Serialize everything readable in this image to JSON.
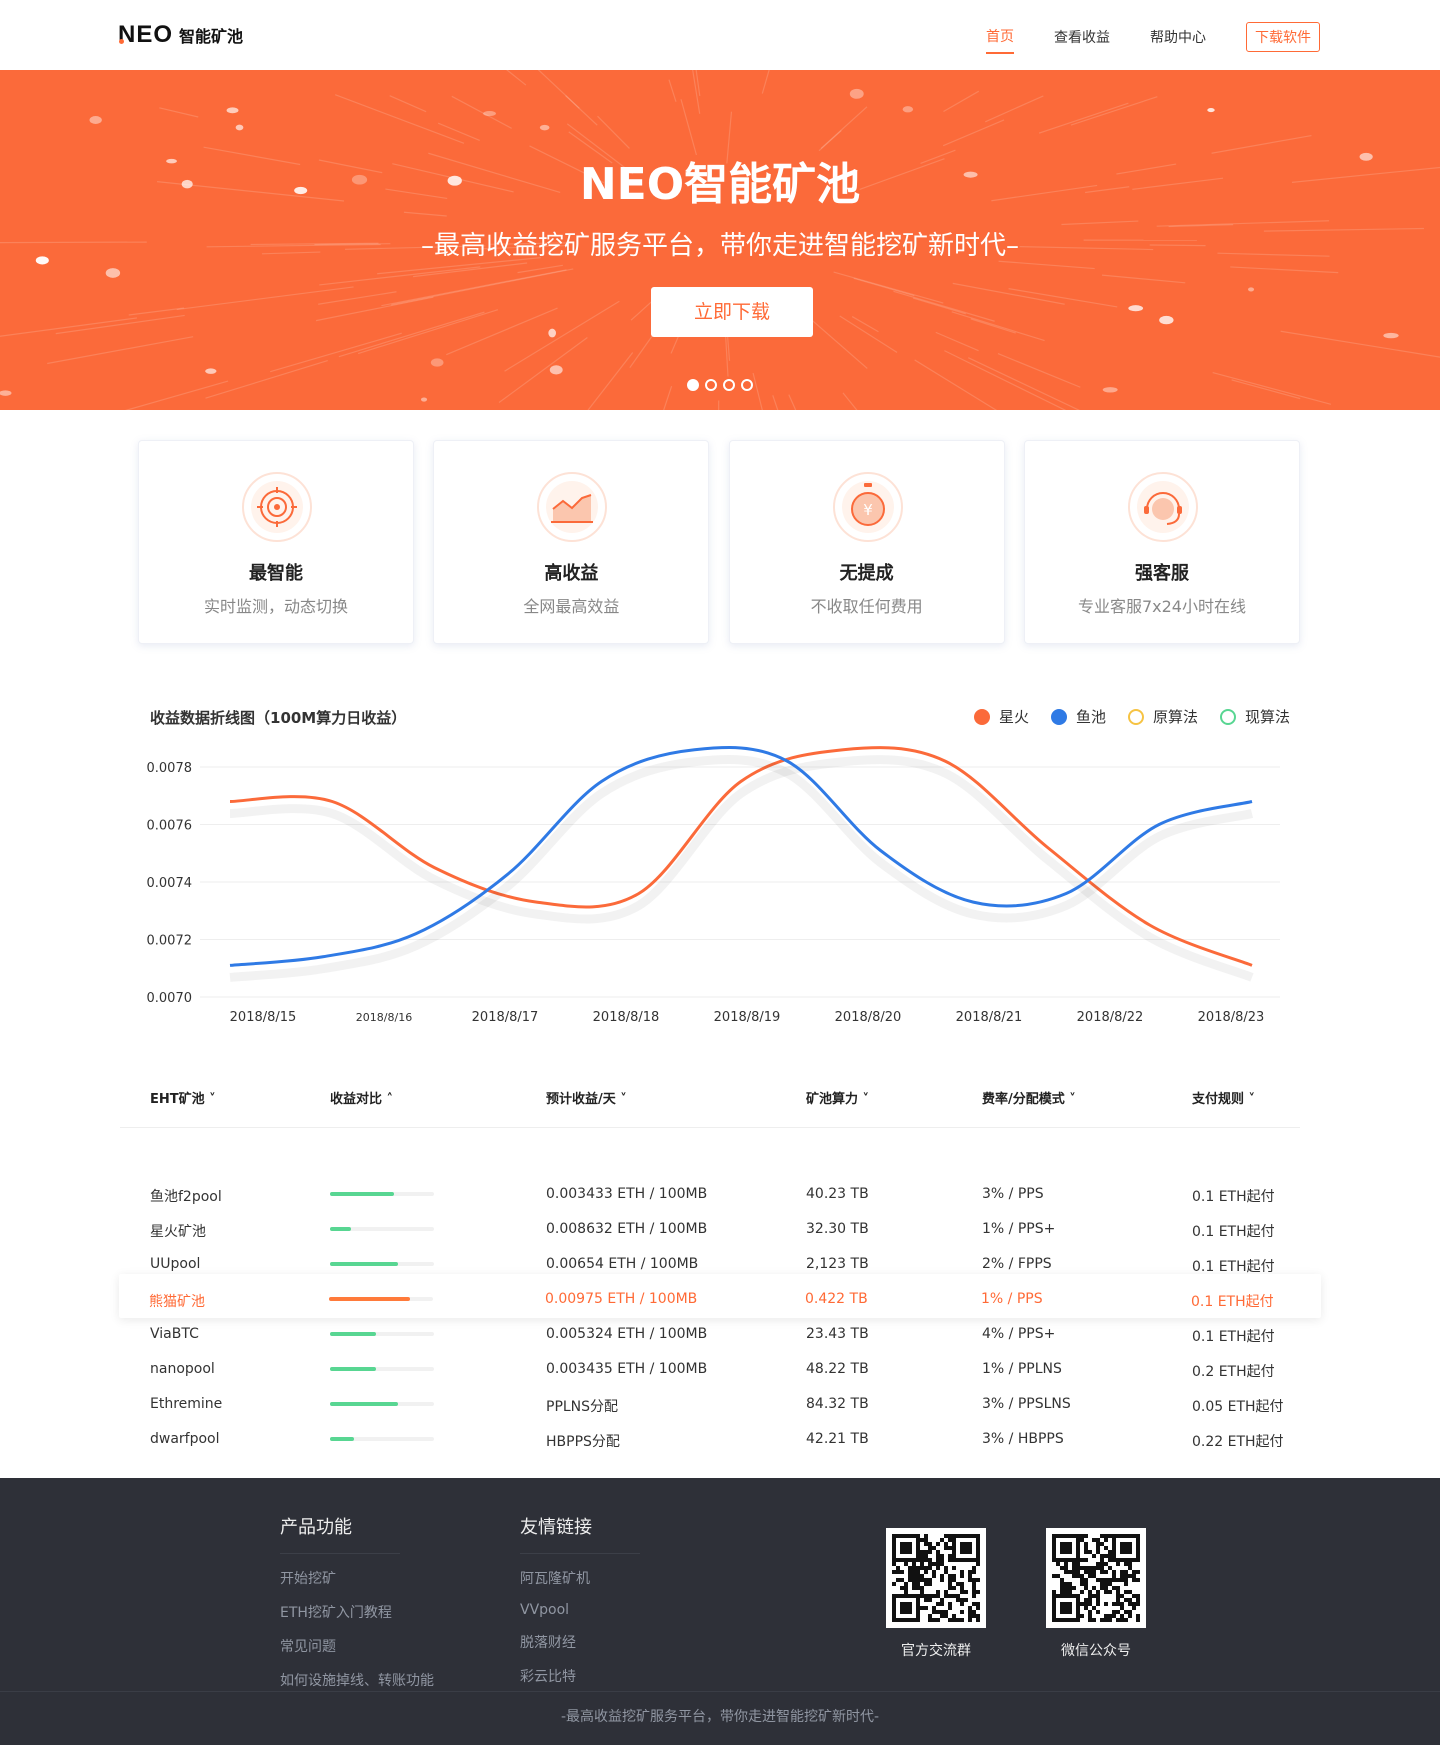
{
  "header": {
    "logo_mark": "NEO",
    "logo_text": "智能矿池",
    "nav": [
      {
        "label": "首页"
      },
      {
        "label": "查看收益"
      },
      {
        "label": "帮助中心"
      }
    ],
    "download_label": "下载软件"
  },
  "banner": {
    "title": "NEO智能矿池",
    "subtitle": "–最高收益挖矿服务平台，带你走进智能挖矿新时代–",
    "button_label": "立即下载",
    "slide_count": 4,
    "active_slide": 0
  },
  "features": [
    {
      "title": "最智能",
      "desc": "实时监测，动态切换",
      "icon": "target-icon"
    },
    {
      "title": "高收益",
      "desc": "全网最高效益",
      "icon": "chart-growth-icon"
    },
    {
      "title": "无提成",
      "desc": "不收取任何费用",
      "icon": "yuan-coin-icon"
    },
    {
      "title": "强客服",
      "desc": "专业客服7x24小时在线",
      "icon": "headset-icon"
    }
  ],
  "chart_section": {
    "title": "收益数据折线图（100M算力日收益）",
    "legend": [
      {
        "label": "星火",
        "color": "#fb6a3a",
        "filled": true
      },
      {
        "label": "鱼池",
        "color": "#2f7ae5",
        "filled": true
      },
      {
        "label": "原算法",
        "color": "#f6c343",
        "filled": false
      },
      {
        "label": "现算法",
        "color": "#58d692",
        "filled": false
      }
    ]
  },
  "chart_data": {
    "type": "line",
    "x": [
      "2018/8/15",
      "2018/8/16",
      "2018/8/17",
      "2018/8/18",
      "2018/8/19",
      "2018/8/20",
      "2018/8/21",
      "2018/8/22",
      "2018/8/23"
    ],
    "ylim": [
      0.007,
      0.0078
    ],
    "yticks": [
      "0.0078",
      "0.0076",
      "0.0074",
      "0.0072",
      "0.0070"
    ],
    "grid": true,
    "series": [
      {
        "name": "星火",
        "color": "#fb6a3a",
        "values": [
          0.00768,
          0.00768,
          0.00745,
          0.00733,
          0.00736,
          0.00775,
          0.00786,
          0.00782,
          0.00752,
          0.00725,
          0.00711
        ]
      },
      {
        "name": "鱼池",
        "color": "#2f7ae5",
        "values": [
          0.00711,
          0.00714,
          0.00722,
          0.00743,
          0.00775,
          0.00786,
          0.00782,
          0.00751,
          0.00733,
          0.00736,
          0.0076,
          0.00768
        ]
      }
    ]
  },
  "table": {
    "headers": [
      "EHT矿池",
      "收益对比",
      "预计收益/天",
      "矿池算力",
      "费率/分配模式",
      "支付规则"
    ],
    "rows": [
      {
        "pool": "鱼池f2pool",
        "ratio": 0.62,
        "income": "0.003433 ETH / 100MB",
        "hashrate": "40.23 TB",
        "fee": "3% / PPS",
        "pay": "0.1 ETH起付",
        "highlight": false
      },
      {
        "pool": "星火矿池",
        "ratio": 0.2,
        "income": "0.008632 ETH / 100MB",
        "hashrate": "32.30 TB",
        "fee": "1% / PPS+",
        "pay": "0.1 ETH起付",
        "highlight": false
      },
      {
        "pool": "UUpool",
        "ratio": 0.65,
        "income": "0.00654 ETH / 100MB",
        "hashrate": "2,123 TB",
        "fee": "2% / FPPS",
        "pay": "0.1 ETH起付",
        "highlight": false
      },
      {
        "pool": "熊猫矿池",
        "ratio": 0.78,
        "income": "0.00975 ETH / 100MB",
        "hashrate": "0.422 TB",
        "fee": "1% / PPS",
        "pay": "0.1 ETH起付",
        "highlight": true
      },
      {
        "pool": "ViaBTC",
        "ratio": 0.44,
        "income": "0.005324 ETH / 100MB",
        "hashrate": "23.43 TB",
        "fee": "4% / PPS+",
        "pay": "0.1 ETH起付",
        "highlight": false
      },
      {
        "pool": "nanopool",
        "ratio": 0.44,
        "income": "0.003435 ETH / 100MB",
        "hashrate": "48.22 TB",
        "fee": "1% / PPLNS",
        "pay": "0.2 ETH起付",
        "highlight": false
      },
      {
        "pool": "Ethremine",
        "ratio": 0.65,
        "income": "PPLNS分配",
        "hashrate": "84.32 TB",
        "fee": "3% / PPSLNS",
        "pay": "0.05 ETH起付",
        "highlight": false
      },
      {
        "pool": "dwarfpool",
        "ratio": 0.23,
        "income": "HBPPS分配",
        "hashrate": "42.21 TB",
        "fee": "3% / HBPPS",
        "pay": "0.22 ETH起付",
        "highlight": false
      }
    ]
  },
  "footer": {
    "col1": {
      "title": "产品功能",
      "links": [
        "开始挖矿",
        "ETH挖矿入门教程",
        "常见问题",
        "如何设施掉线、转账功能"
      ]
    },
    "col2": {
      "title": "友情链接",
      "links": [
        "阿瓦隆矿机",
        "VVpool",
        "脱落财经",
        "彩云比特"
      ]
    },
    "qr": [
      {
        "label": "官方交流群"
      },
      {
        "label": "微信公众号"
      }
    ],
    "tagline": "-最高收益挖矿服务平台，带你走进智能挖矿新时代-"
  },
  "colors": {
    "accent": "#fb6a3a",
    "blue": "#2f7ae5",
    "green": "#58d692",
    "footer_bg": "#2e3038"
  }
}
